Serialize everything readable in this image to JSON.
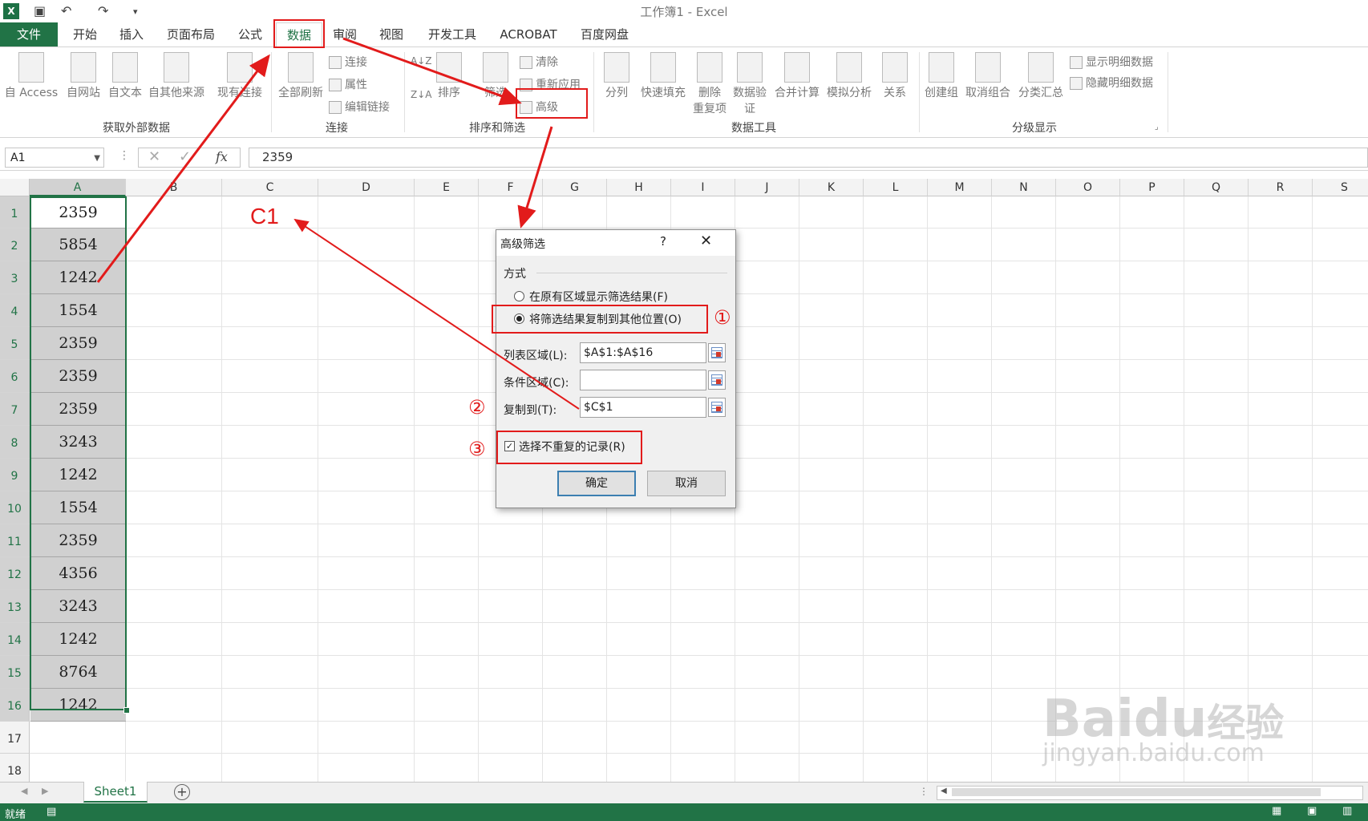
{
  "window": {
    "title": "工作簿1 - Excel",
    "logo": "X"
  },
  "tabs": [
    "文件",
    "开始",
    "插入",
    "页面布局",
    "公式",
    "数据",
    "审阅",
    "视图",
    "开发工具",
    "ACROBAT",
    "百度网盘"
  ],
  "ribbon": {
    "ext": {
      "access": "自 Access",
      "web": "自网站",
      "text": "自文本",
      "other": "自其他来源",
      "existing": "现有连接",
      "group": "获取外部数据"
    },
    "conn": {
      "refresh": "全部刷新",
      "connections": "连接",
      "properties": "属性",
      "edit_links": "编辑链接",
      "group": "连接"
    },
    "sort": {
      "sort": "排序",
      "filter": "筛选",
      "clear": "清除",
      "reapply": "重新应用",
      "advanced": "高级",
      "group": "排序和筛选"
    },
    "tools": {
      "split": "分列",
      "flash": "快速填充",
      "dup1": "删除",
      "dup2": "重复项",
      "valid1": "数据验",
      "valid2": "证",
      "consol": "合并计算",
      "whatif": "模拟分析",
      "relations": "关系",
      "group": "数据工具"
    },
    "outline": {
      "group_btn": "创建组",
      "ungroup": "取消组合",
      "subtotal": "分类汇总",
      "show": "显示明细数据",
      "hide": "隐藏明细数据",
      "group": "分级显示"
    }
  },
  "formula_bar": {
    "name_box": "A1",
    "fx": "fx",
    "value": "2359"
  },
  "columns": [
    "A",
    "B",
    "C",
    "D",
    "E",
    "F",
    "G",
    "H",
    "I",
    "J",
    "K",
    "L",
    "M",
    "N",
    "O",
    "P",
    "Q",
    "R",
    "S"
  ],
  "rows": [
    "1",
    "2",
    "3",
    "4",
    "5",
    "6",
    "7",
    "8",
    "9",
    "10",
    "11",
    "12",
    "13",
    "14",
    "15",
    "16",
    "17",
    "18"
  ],
  "cells_A": [
    "2359",
    "5854",
    "1242",
    "1554",
    "2359",
    "2359",
    "2359",
    "3243",
    "1242",
    "1554",
    "2359",
    "4356",
    "3243",
    "1242",
    "8764",
    "1242"
  ],
  "dialog": {
    "title": "高级筛选",
    "help": "?",
    "close": "✕",
    "section": "方式",
    "option1": "在原有区域显示筛选结果(F)",
    "option2": "将筛选结果复制到其他位置(O)",
    "list_label": "列表区域(L):",
    "list_value": "$A$1:$A$16",
    "criteria_label": "条件区域(C):",
    "criteria_value": "",
    "copy_label": "复制到(T):",
    "copy_value": "$C$1",
    "unique_label": "选择不重复的记录(R)",
    "ok": "确定",
    "cancel": "取消"
  },
  "annotations": {
    "c1": "C1",
    "n1": "①",
    "n2": "②",
    "n3": "③",
    "color": "#e21b1b"
  },
  "sheet": {
    "name": "Sheet1",
    "add": "+"
  },
  "status": {
    "text": "就绪"
  },
  "watermark": {
    "brand": "Bai",
    "paw": "du",
    "site": "经验",
    "url": "jingyan.baidu.com"
  }
}
